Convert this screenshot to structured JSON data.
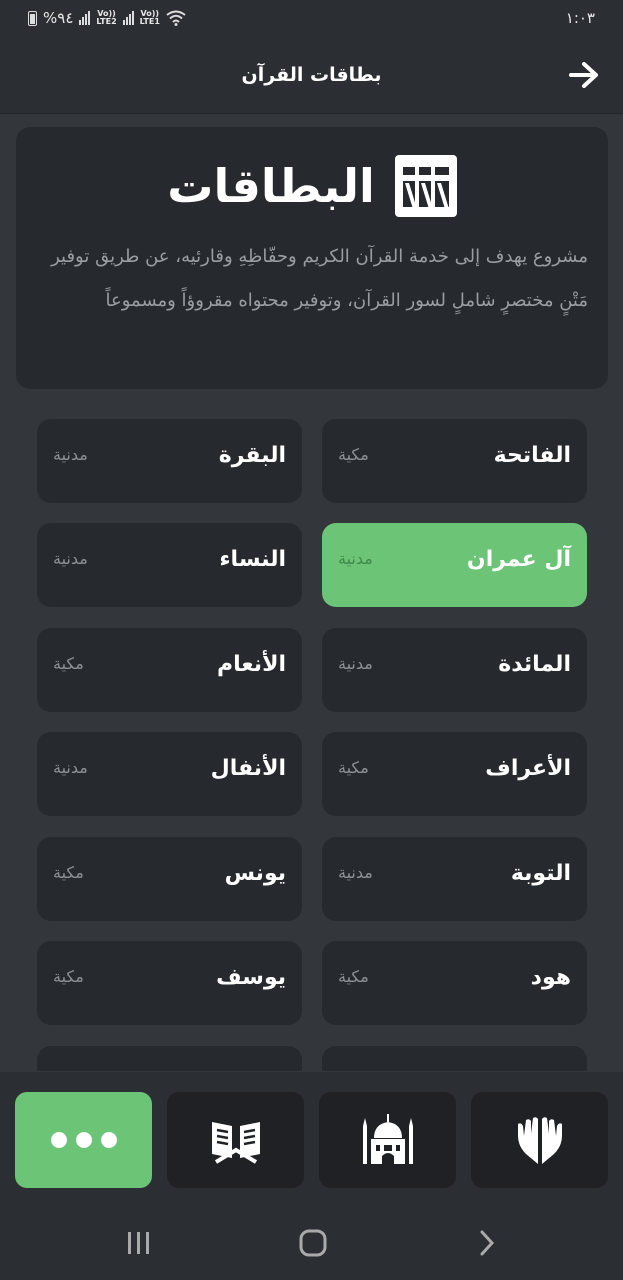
{
  "status_bar": {
    "battery": "%٩٤",
    "sim1": "LTE2",
    "sim2": "LTE1",
    "volte": "Vo))",
    "time": "١:٠٣"
  },
  "header": {
    "title": "بطاقات القرآن",
    "back_icon": "arrow-right-icon"
  },
  "intro": {
    "brand_name": "البطاقات",
    "logo_icon": "cards-logo-icon",
    "description": "مشروع يهدف إلى خدمة القرآن الكريم وحفّاظِهِ وقارئيه، عن طريق توفير مَتْنٍ مختصرٍ شاملٍ لسور القرآن، وتوفير محتواه مقروؤاً ومسموعاً"
  },
  "surahs": [
    {
      "name": "الفاتحة",
      "type": "مكية",
      "active": false
    },
    {
      "name": "البقرة",
      "type": "مدنية",
      "active": false
    },
    {
      "name": "آل عمران",
      "type": "مدنية",
      "active": true
    },
    {
      "name": "النساء",
      "type": "مدنية",
      "active": false
    },
    {
      "name": "المائدة",
      "type": "مدنية",
      "active": false
    },
    {
      "name": "الأنعام",
      "type": "مكية",
      "active": false
    },
    {
      "name": "الأعراف",
      "type": "مكية",
      "active": false
    },
    {
      "name": "الأنفال",
      "type": "مدنية",
      "active": false
    },
    {
      "name": "التوبة",
      "type": "مدنية",
      "active": false
    },
    {
      "name": "يونس",
      "type": "مكية",
      "active": false
    },
    {
      "name": "هود",
      "type": "مكية",
      "active": false
    },
    {
      "name": "يوسف",
      "type": "مكية",
      "active": false
    },
    {
      "name": "",
      "type": "",
      "active": false
    },
    {
      "name": "",
      "type": "",
      "active": false
    }
  ],
  "bottom_nav": [
    {
      "icon": "more-dots-icon",
      "active": true
    },
    {
      "icon": "open-book-icon",
      "active": false
    },
    {
      "icon": "mosque-icon",
      "active": false
    },
    {
      "icon": "praying-hands-icon",
      "active": false
    }
  ],
  "colors": {
    "accent": "#6cc477",
    "background": "#33373c",
    "card": "#26292d",
    "header": "#2b2e32"
  }
}
